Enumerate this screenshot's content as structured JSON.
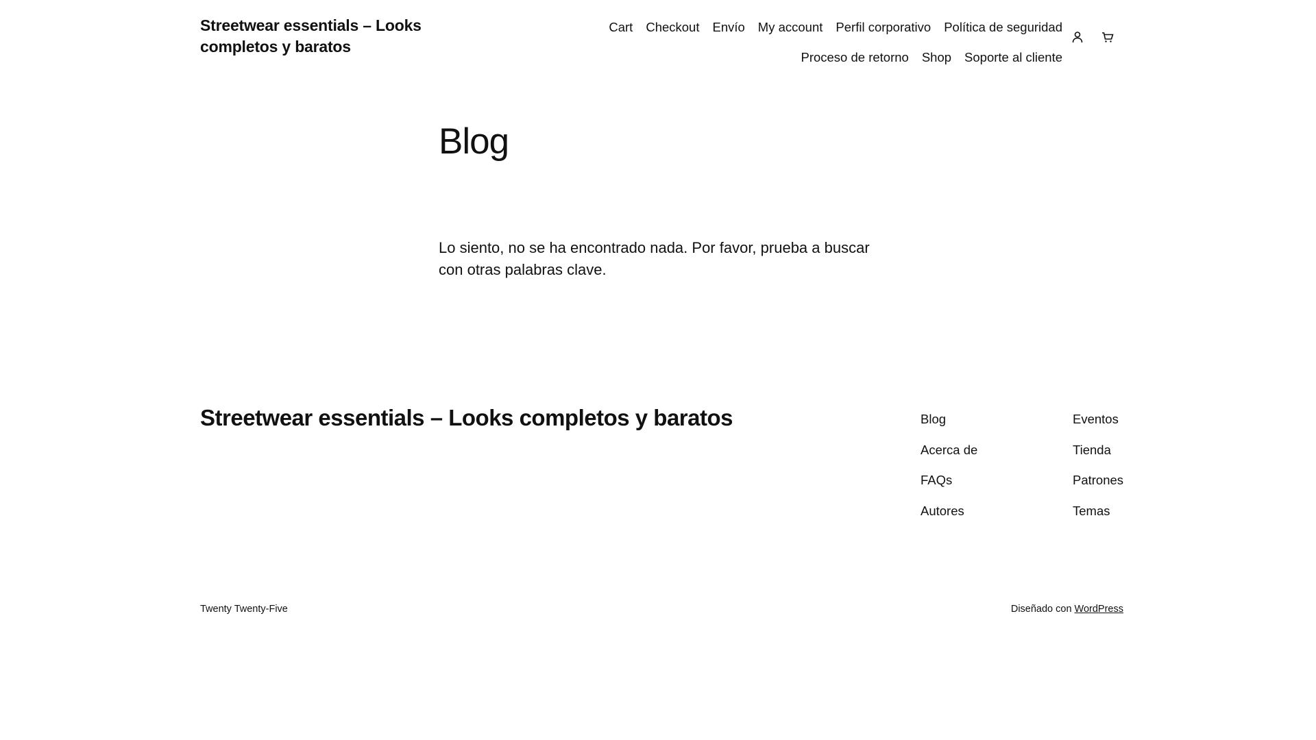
{
  "header": {
    "site_title": "Streetwear essentials – Looks completos y baratos",
    "nav_row1": [
      "Cart",
      "Checkout",
      "Envío",
      "My account",
      "Perfil corporativo",
      "Política de seguridad"
    ],
    "nav_row2": [
      "Proceso de retorno",
      "Shop",
      "Soporte al cliente"
    ],
    "icons": [
      "account-icon",
      "cart-icon"
    ]
  },
  "main": {
    "title": "Blog",
    "message": "Lo siento, no se ha encontrado nada. Por favor, prueba a buscar con otras palabras clave."
  },
  "footer": {
    "site_title": "Streetwear essentials – Looks completos y baratos",
    "col1": [
      "Blog",
      "Acerca de",
      "FAQs",
      "Autores"
    ],
    "col2": [
      "Eventos",
      "Tienda",
      "Patrones",
      "Temas"
    ],
    "theme_credit": "Twenty Twenty-Five",
    "designed_with": "Diseñado con",
    "wordpress_link": "WordPress"
  }
}
